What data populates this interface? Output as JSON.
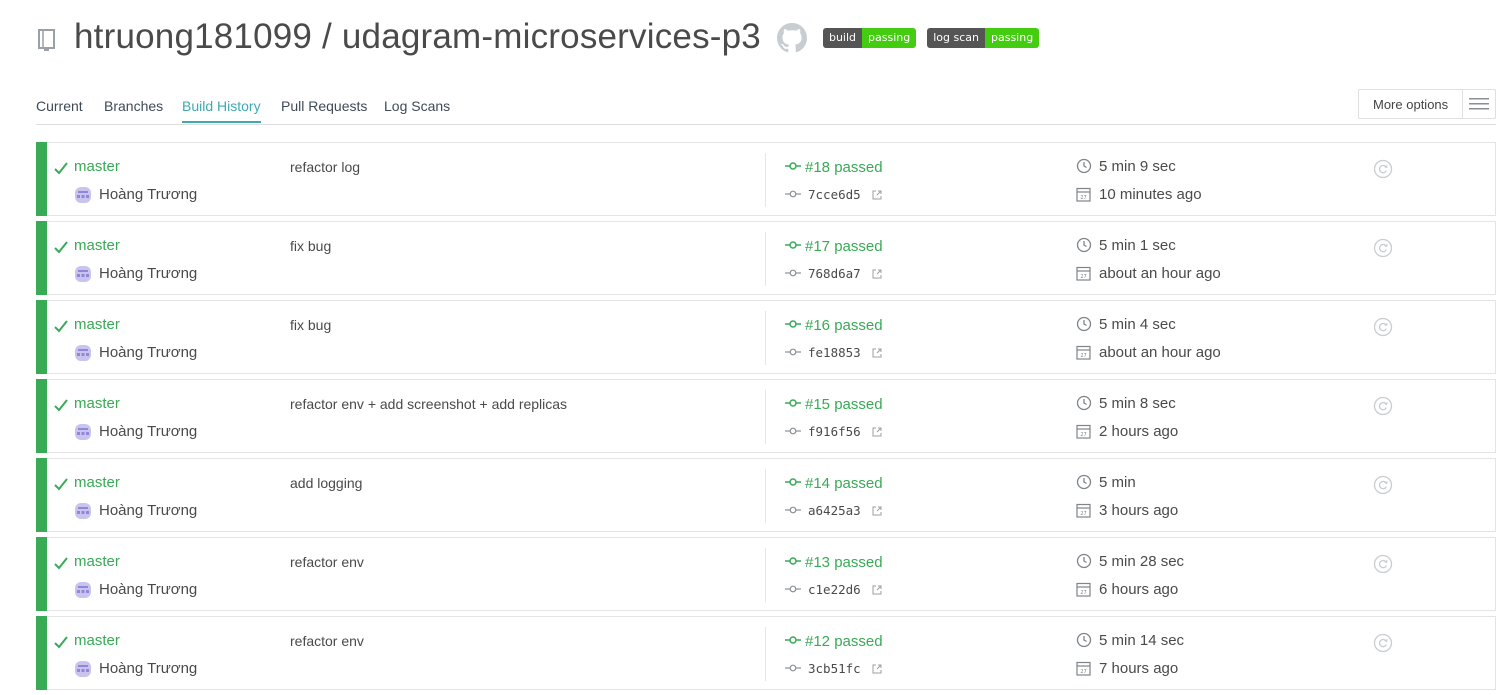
{
  "repo": {
    "owner": "htruong181099",
    "name": "udagram-microservices-p3",
    "title": "htruong181099 / udagram-microservices-p3"
  },
  "badges": [
    {
      "left": "build",
      "right": "passing"
    },
    {
      "left": "log scan",
      "right": "passing"
    }
  ],
  "tabs": [
    {
      "label": "Current"
    },
    {
      "label": "Branches"
    },
    {
      "label": "Build History",
      "active": true
    },
    {
      "label": "Pull Requests"
    },
    {
      "label": "Log Scans"
    }
  ],
  "more_options_label": "More options",
  "colors": {
    "passed": "#39aa56",
    "active_tab": "#3eaaaf",
    "badge_green": "#44cc11"
  },
  "builds": [
    {
      "branch": "master",
      "author": "Hoàng Trương",
      "message": "refactor log",
      "number": "#18 passed",
      "sha": "7cce6d5",
      "duration": "5 min 9 sec",
      "finished": "10 minutes ago"
    },
    {
      "branch": "master",
      "author": "Hoàng Trương",
      "message": "fix bug",
      "number": "#17 passed",
      "sha": "768d6a7",
      "duration": "5 min 1 sec",
      "finished": "about an hour ago"
    },
    {
      "branch": "master",
      "author": "Hoàng Trương",
      "message": "fix bug",
      "number": "#16 passed",
      "sha": "fe18853",
      "duration": "5 min 4 sec",
      "finished": "about an hour ago"
    },
    {
      "branch": "master",
      "author": "Hoàng Trương",
      "message": "refactor env + add screenshot + add replicas",
      "number": "#15 passed",
      "sha": "f916f56",
      "duration": "5 min 8 sec",
      "finished": "2 hours ago"
    },
    {
      "branch": "master",
      "author": "Hoàng Trương",
      "message": "add logging",
      "number": "#14 passed",
      "sha": "a6425a3",
      "duration": "5 min",
      "finished": "3 hours ago"
    },
    {
      "branch": "master",
      "author": "Hoàng Trương",
      "message": "refactor env",
      "number": "#13 passed",
      "sha": "c1e22d6",
      "duration": "5 min 28 sec",
      "finished": "6 hours ago"
    },
    {
      "branch": "master",
      "author": "Hoàng Trương",
      "message": "refactor env",
      "number": "#12 passed",
      "sha": "3cb51fc",
      "duration": "5 min 14 sec",
      "finished": "7 hours ago"
    }
  ]
}
